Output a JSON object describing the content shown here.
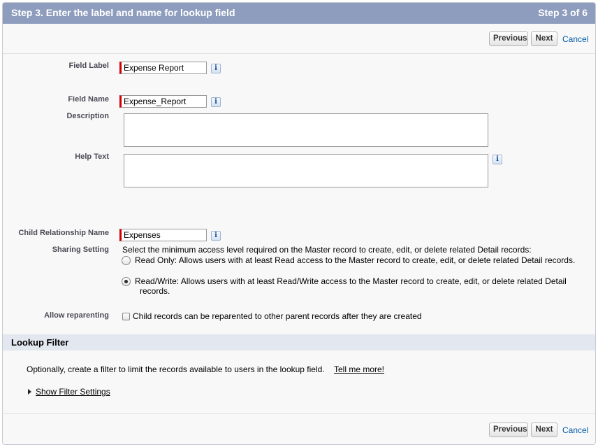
{
  "header": {
    "title": "Step 3. Enter the label and name for lookup field",
    "step": "Step 3 of 6"
  },
  "buttons": {
    "previous": "Previous",
    "next": "Next",
    "cancel": "Cancel"
  },
  "form": {
    "field_label": {
      "label": "Field Label",
      "value": "Expense Report",
      "info_icon": "i"
    },
    "field_name": {
      "label": "Field Name",
      "value": "Expense_Report",
      "info_icon": "i"
    },
    "description": {
      "label": "Description",
      "value": ""
    },
    "help_text": {
      "label": "Help Text",
      "value": "",
      "info_icon": "i"
    },
    "child_relationship": {
      "label": "Child Relationship Name",
      "value": "Expenses",
      "info_icon": "i"
    },
    "sharing": {
      "label": "Sharing Setting",
      "intro": "Select the minimum access level required on the Master record to create, edit, or delete related Detail records:",
      "options": [
        {
          "label": "Read Only: Allows users with at least Read access to the Master record to create, edit, or delete related Detail records.",
          "checked": false
        },
        {
          "label_line1": "Read/Write: Allows users with at least Read/Write access to the Master record to create, edit, or delete related Detail",
          "label_line2": "records.",
          "checked": true
        }
      ]
    },
    "reparenting": {
      "label": "Allow reparenting",
      "checkbox_label": "Child records can be reparented to other parent records after they are created",
      "checked": false
    }
  },
  "lookup_filter": {
    "title": "Lookup Filter",
    "description": "Optionally, create a filter to limit the records available to users in the lookup field.",
    "tell_me_more": "Tell me more!",
    "show_settings": "Show Filter Settings"
  },
  "colors": {
    "header_bg": "#8e9dbe",
    "required_bar": "#cc0000",
    "link": "#015ba7",
    "section_bg": "#e3e7ef"
  }
}
